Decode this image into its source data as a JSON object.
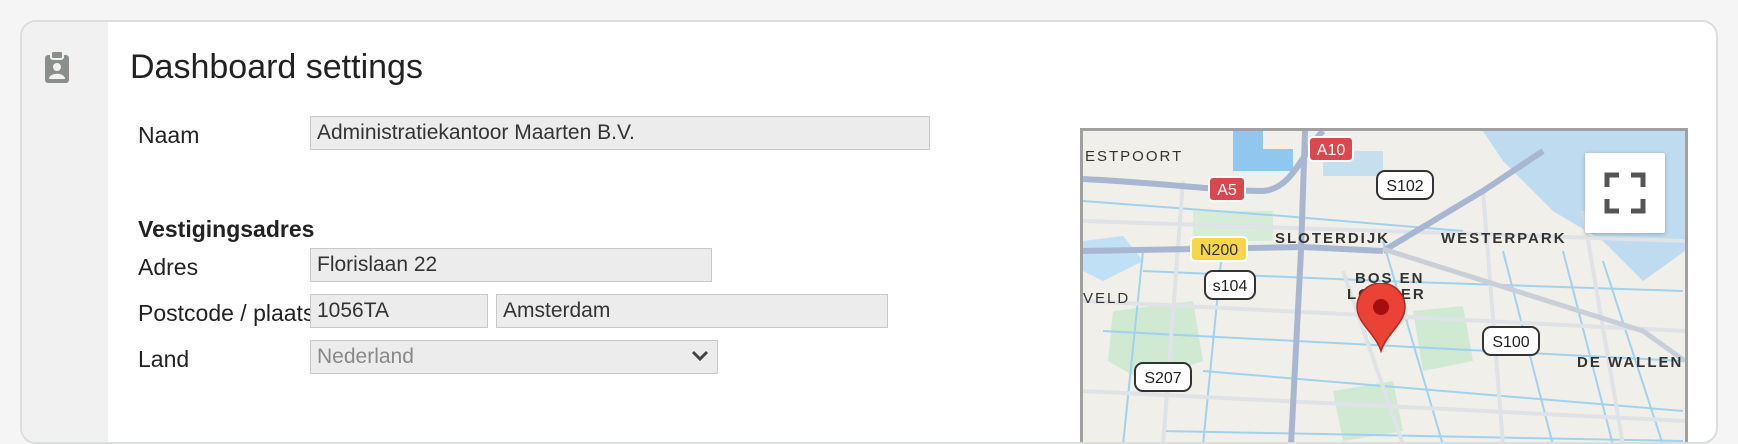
{
  "page": {
    "title": "Dashboard settings"
  },
  "sidebar": {
    "icon": "clipboard-icon"
  },
  "form": {
    "naam": {
      "label": "Naam",
      "value": "Administratiekantoor Maarten B.V."
    },
    "section_title": "Vestigingsadres",
    "adres": {
      "label": "Adres",
      "value": "Florislaan 22"
    },
    "postcode_plaats": {
      "label": "Postcode / plaats",
      "postcode": "1056TA",
      "plaats": "Amsterdam"
    },
    "land": {
      "label": "Land",
      "selected": "Nederland"
    }
  },
  "map": {
    "labels": {
      "westpoort": "ESTPOORT",
      "a10": "A10",
      "a5": "A5",
      "s102": "S102",
      "n200": "N200",
      "sloterdijk": "SLOTERDIJK",
      "westerpark": "WESTERPARK",
      "s104": "s104",
      "bos_en_lommer_1": "BOS EN",
      "bos_en_lommer_2": "LOMMER",
      "veld": "VELD",
      "s100": "S100",
      "de_wallen": "DE WALLEN",
      "s207": "S207"
    },
    "marker": "map-pin-icon",
    "fullscreen": "fullscreen-icon"
  }
}
